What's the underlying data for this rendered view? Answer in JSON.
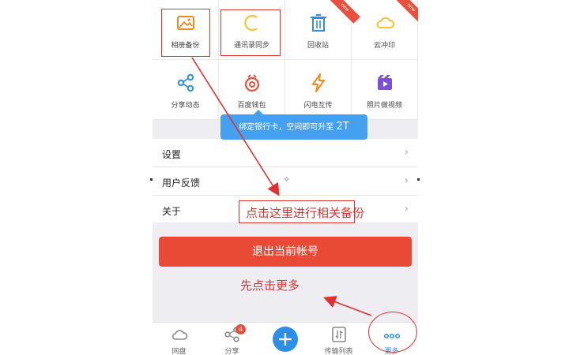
{
  "grid": [
    {
      "label": "相册备份",
      "icon": "photo-icon",
      "color": "#f08a1c",
      "is_new": false
    },
    {
      "label": "通讯录同步",
      "icon": "contacts-sync-icon",
      "color": "#f2c531",
      "is_new": false
    },
    {
      "label": "回收站",
      "icon": "trash-icon",
      "color": "#2d8ee8",
      "is_new": true,
      "new_label": "new"
    },
    {
      "label": "云冲印",
      "icon": "cloud-print-icon",
      "color": "#f2c531",
      "is_new": true,
      "new_label": "new"
    },
    {
      "label": "分享动态",
      "icon": "share-icon",
      "color": "#2d8ee8",
      "is_new": false
    },
    {
      "label": "百度钱包",
      "icon": "wallet-icon",
      "color": "#e94f3c",
      "is_new": false
    },
    {
      "label": "闪电互传",
      "icon": "lightning-icon",
      "color": "#f08a1c",
      "is_new": false
    },
    {
      "label": "照片做视频",
      "icon": "video-icon",
      "color": "#7b4fd6",
      "is_new": false
    }
  ],
  "tooltip": {
    "text": "绑定银行卡，空间即可升至",
    "highlight": "2T"
  },
  "menu": [
    {
      "label": "设置"
    },
    {
      "label": "用户反馈"
    },
    {
      "label": "关于"
    }
  ],
  "logout_label": "退出当前帐号",
  "tabs": [
    {
      "label": "网盘",
      "icon": "cloud-icon",
      "badge": null
    },
    {
      "label": "分享",
      "icon": "share-icon",
      "badge": "4"
    },
    {
      "label": "",
      "icon": "plus-icon",
      "badge": null
    },
    {
      "label": "传输列表",
      "icon": "transfer-icon",
      "badge": null
    },
    {
      "label": "更多",
      "icon": "more-icon",
      "badge": null,
      "active": true
    }
  ],
  "annotations": {
    "backup_note": "点击这里进行相关备份",
    "more_note": "先点击更多",
    "color": "#e03030"
  },
  "colors": {
    "accent": "#2d8ee8",
    "danger": "#e94a36"
  }
}
